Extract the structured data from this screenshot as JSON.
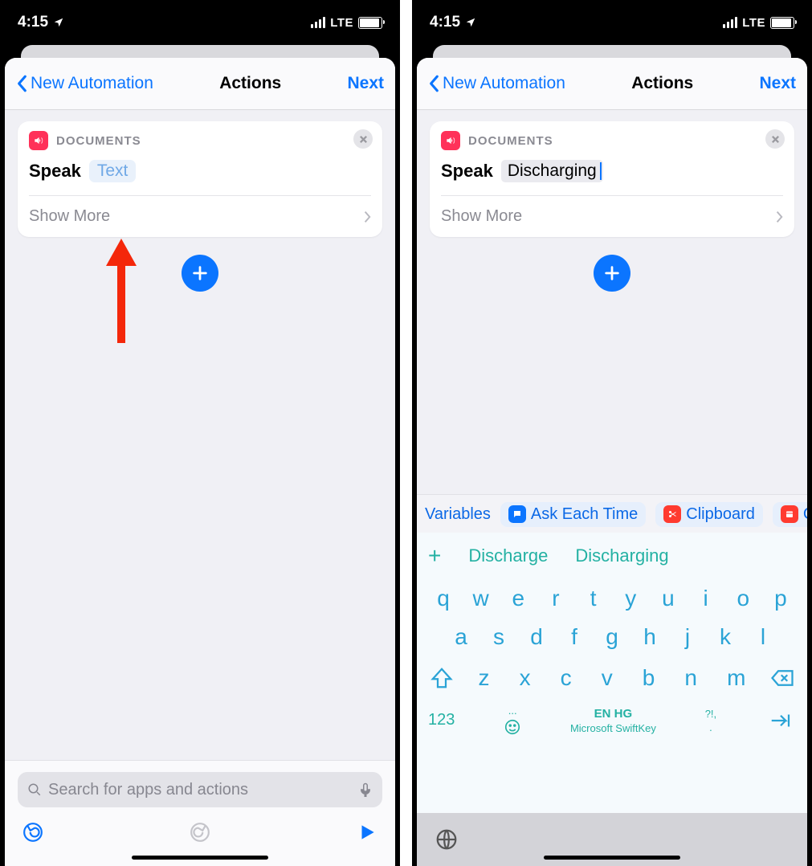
{
  "status": {
    "time": "4:15",
    "network": "LTE"
  },
  "nav": {
    "back": "New Automation",
    "title": "Actions",
    "next": "Next"
  },
  "card": {
    "source": "DOCUMENTS",
    "action": "Speak",
    "placeholder": "Text",
    "typed": "Discharging",
    "more": "Show More"
  },
  "search": {
    "placeholder": "Search for apps and actions"
  },
  "variables": {
    "label": "Variables",
    "chips": [
      "Ask Each Time",
      "Clipboard",
      "Cur"
    ]
  },
  "suggestions": {
    "items": [
      "Discharge",
      "Discharging"
    ]
  },
  "keyboard": {
    "row1": [
      "q",
      "w",
      "e",
      "r",
      "t",
      "y",
      "u",
      "i",
      "o",
      "p"
    ],
    "row2": [
      "a",
      "s",
      "d",
      "f",
      "g",
      "h",
      "j",
      "k",
      "l"
    ],
    "row3": [
      "z",
      "x",
      "c",
      "v",
      "b",
      "n",
      "m"
    ],
    "numKey": "123",
    "lang": "EN HG",
    "brand": "Microsoft SwiftKey",
    "punct1": "...",
    "punct2": "?!,",
    "dot": "."
  }
}
